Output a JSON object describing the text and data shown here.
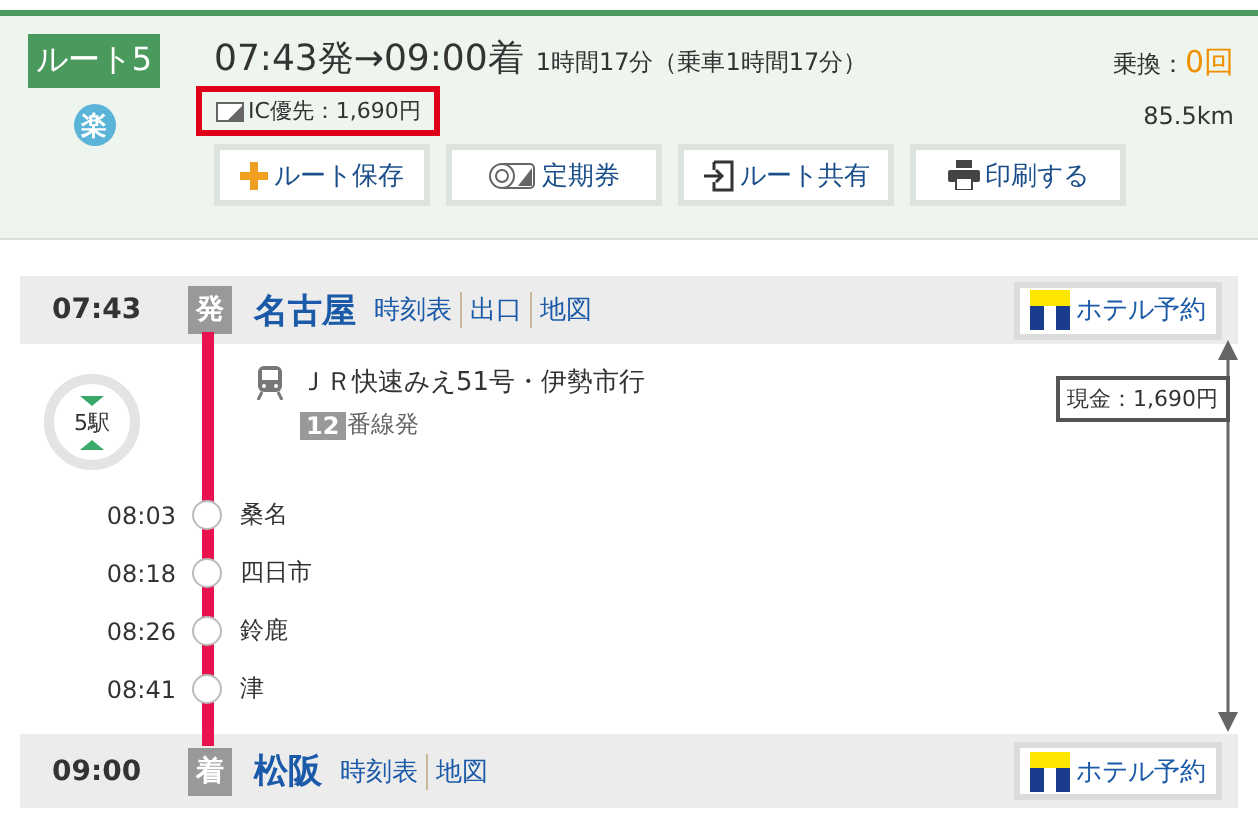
{
  "summary": {
    "route_label": "ルート5",
    "comfort_mark": "楽",
    "times": "07:43発→09:00着",
    "duration": "1時間17分（乗車1時間17分）",
    "ic_fare": "IC優先：1,690円",
    "ic_fare_highlighted": true,
    "transfers_label": "乗換：",
    "transfers": "0回",
    "distance": "85.5km",
    "actions": [
      {
        "kind": "save",
        "label": "ルート保存"
      },
      {
        "kind": "pass",
        "label": "定期券"
      },
      {
        "kind": "share",
        "label": "ルート共有"
      },
      {
        "kind": "print",
        "label": "印刷する"
      }
    ]
  },
  "departure": {
    "time": "07:43",
    "badge": "発",
    "station": "名古屋",
    "links": [
      "時刻表",
      "出口",
      "地図"
    ],
    "hotel": "ホテル予約"
  },
  "leg": {
    "stop_count": "5駅",
    "train": "ＪＲ快速みえ51号・伊勢市行",
    "platform": "12",
    "platform_suffix": "番線発",
    "cash_fare": "現金：1,690円",
    "stops": [
      {
        "time": "08:03",
        "name": "桑名"
      },
      {
        "time": "08:18",
        "name": "四日市"
      },
      {
        "time": "08:26",
        "name": "鈴鹿"
      },
      {
        "time": "08:41",
        "name": "津"
      }
    ]
  },
  "arrival": {
    "time": "09:00",
    "badge": "着",
    "station": "松阪",
    "links": [
      "時刻表",
      "地図"
    ],
    "hotel": "ホテル予約"
  }
}
